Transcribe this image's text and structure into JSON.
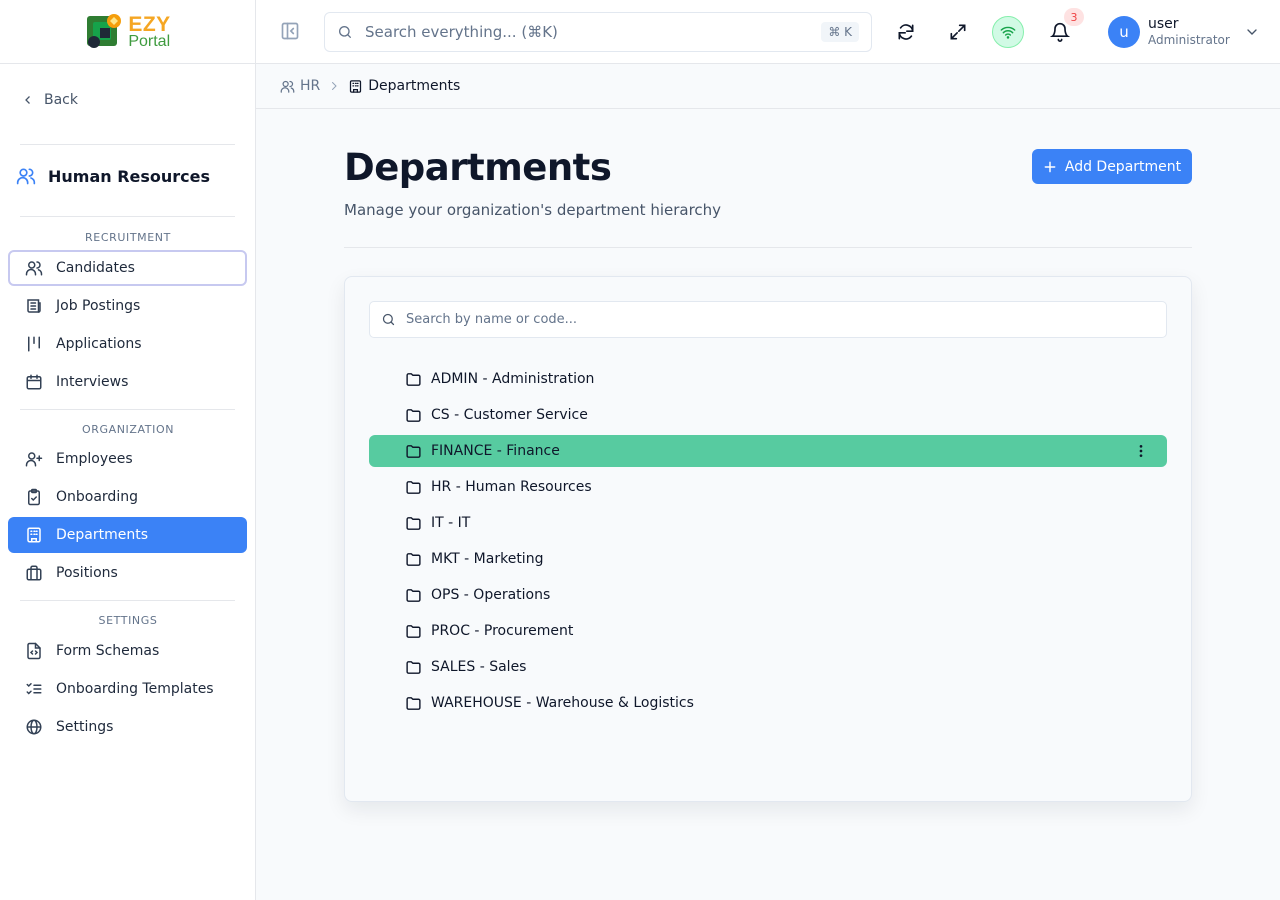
{
  "brand": {
    "name_top": "EZY",
    "name_bottom": "Portal"
  },
  "sidebar": {
    "back_label": "Back",
    "module_title": "Human Resources",
    "sections": [
      {
        "label": "RECRUITMENT",
        "items": [
          {
            "label": "Candidates",
            "icon": "users-icon"
          },
          {
            "label": "Job Postings",
            "icon": "newspaper-icon"
          },
          {
            "label": "Applications",
            "icon": "kanban-icon"
          },
          {
            "label": "Interviews",
            "icon": "calendar-icon"
          }
        ]
      },
      {
        "label": "ORGANIZATION",
        "items": [
          {
            "label": "Employees",
            "icon": "user-plus-icon"
          },
          {
            "label": "Onboarding",
            "icon": "clipboard-check-icon"
          },
          {
            "label": "Departments",
            "icon": "building-icon",
            "active": true
          },
          {
            "label": "Positions",
            "icon": "briefcase-icon"
          }
        ]
      },
      {
        "label": "SETTINGS",
        "items": [
          {
            "label": "Form Schemas",
            "icon": "file-code-icon"
          },
          {
            "label": "Onboarding Templates",
            "icon": "list-checks-icon"
          },
          {
            "label": "Settings",
            "icon": "globe-icon"
          }
        ]
      }
    ]
  },
  "header": {
    "search_placeholder": "Search everything... (⌘K)",
    "search_shortcut": "⌘ K",
    "notification_count": "3",
    "user": {
      "initial": "u",
      "name": "user",
      "role": "Administrator"
    }
  },
  "breadcrumb": [
    {
      "label": "HR"
    },
    {
      "label": "Departments"
    }
  ],
  "page": {
    "title": "Departments",
    "subtitle": "Manage your organization's department hierarchy",
    "add_button_label": "Add Department",
    "filter_placeholder": "Search by name or code..."
  },
  "departments": [
    {
      "label": "ADMIN - Administration"
    },
    {
      "label": "CS - Customer Service"
    },
    {
      "label": "FINANCE - Finance",
      "selected": true
    },
    {
      "label": "HR - Human Resources"
    },
    {
      "label": "IT - IT"
    },
    {
      "label": "MKT - Marketing"
    },
    {
      "label": "OPS - Operations"
    },
    {
      "label": "PROC - Procurement"
    },
    {
      "label": "SALES - Sales"
    },
    {
      "label": "WAREHOUSE - Warehouse & Logistics"
    }
  ],
  "colors": {
    "accent": "#3b82f6",
    "selected_row": "#57cba0",
    "brand_orange": "#f5a623",
    "brand_green": "#3f9b3f"
  }
}
